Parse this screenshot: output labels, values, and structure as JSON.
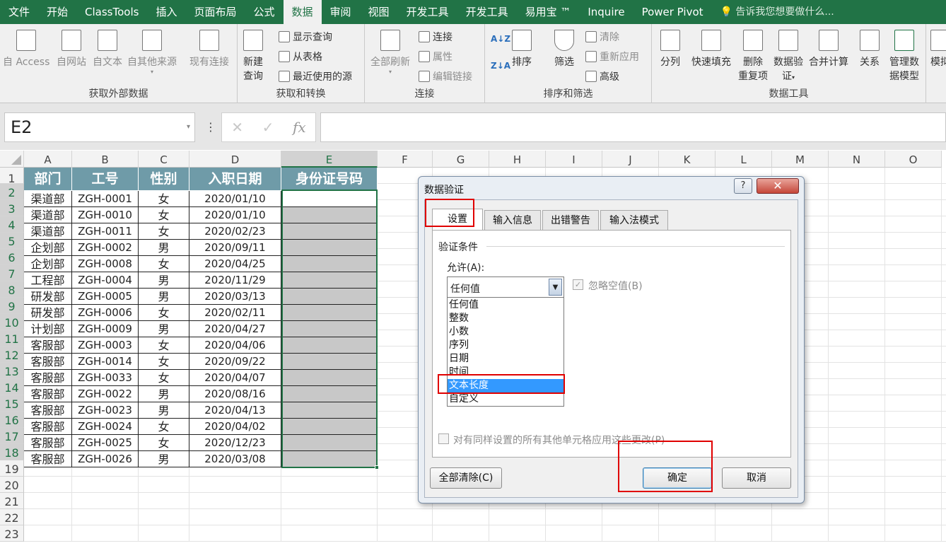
{
  "menu": {
    "tabs": [
      "文件",
      "开始",
      "ClassTools",
      "插入",
      "页面布局",
      "公式",
      "数据",
      "审阅",
      "视图",
      "开发工具",
      "开发工具",
      "易用宝 ™",
      "Inquire",
      "Power Pivot"
    ],
    "active_index": 6,
    "tell_me": "告诉我您想要做什么..."
  },
  "ribbon": {
    "get_external": {
      "label": "获取外部数据",
      "from_access": "自 Access",
      "from_web": "自网站",
      "from_text": "自文本",
      "from_other": "自其他来源",
      "existing": "现有连接"
    },
    "get_transform": {
      "label": "获取和转换",
      "new_query_1": "新建",
      "new_query_2": "查询",
      "show_query": "显示查询",
      "from_table": "从表格",
      "recent": "最近使用的源"
    },
    "connections": {
      "label": "连接",
      "refresh_all": "全部刷新",
      "connections": "连接",
      "properties": "属性",
      "edit_links": "编辑链接"
    },
    "sort_filter": {
      "label": "排序和筛选",
      "sort": "排序",
      "filter": "筛选",
      "clear": "清除",
      "reapply": "重新应用",
      "advanced": "高级"
    },
    "data_tools": {
      "label": "数据工具",
      "split": "分列",
      "flash_fill": "快速填充",
      "remove_dup_1": "删除",
      "remove_dup_2": "重复项",
      "validation_1": "数据验",
      "validation_2": "证",
      "consolidate": "合并计算",
      "relationships": "关系",
      "manage_model_1": "管理数",
      "manage_model_2": "据模型",
      "what_if": "模拟"
    }
  },
  "formula_bar": {
    "name_box": "E2",
    "fx": "fx",
    "cancel": "✕",
    "enter": "✓"
  },
  "sheet": {
    "columns": [
      "A",
      "B",
      "C",
      "D",
      "E",
      "F",
      "G",
      "H",
      "I",
      "J",
      "K",
      "L",
      "M",
      "N",
      "O"
    ],
    "headers": [
      "部门",
      "工号",
      "性别",
      "入职日期",
      "身份证号码"
    ],
    "rows": [
      [
        "渠道部",
        "ZGH-0001",
        "女",
        "2020/01/10"
      ],
      [
        "渠道部",
        "ZGH-0010",
        "女",
        "2020/01/10"
      ],
      [
        "渠道部",
        "ZGH-0011",
        "女",
        "2020/02/23"
      ],
      [
        "企划部",
        "ZGH-0002",
        "男",
        "2020/09/11"
      ],
      [
        "企划部",
        "ZGH-0008",
        "女",
        "2020/04/25"
      ],
      [
        "工程部",
        "ZGH-0004",
        "男",
        "2020/11/29"
      ],
      [
        "研发部",
        "ZGH-0005",
        "男",
        "2020/03/13"
      ],
      [
        "研发部",
        "ZGH-0006",
        "女",
        "2020/02/11"
      ],
      [
        "计划部",
        "ZGH-0009",
        "男",
        "2020/04/27"
      ],
      [
        "客服部",
        "ZGH-0003",
        "女",
        "2020/04/06"
      ],
      [
        "客服部",
        "ZGH-0014",
        "女",
        "2020/09/22"
      ],
      [
        "客服部",
        "ZGH-0033",
        "女",
        "2020/04/07"
      ],
      [
        "客服部",
        "ZGH-0022",
        "男",
        "2020/08/16"
      ],
      [
        "客服部",
        "ZGH-0023",
        "男",
        "2020/04/13"
      ],
      [
        "客服部",
        "ZGH-0024",
        "女",
        "2020/04/02"
      ],
      [
        "客服部",
        "ZGH-0025",
        "女",
        "2020/12/23"
      ],
      [
        "客服部",
        "ZGH-0026",
        "男",
        "2020/03/08"
      ]
    ],
    "row_numbers": [
      "1",
      "2",
      "3",
      "4",
      "5",
      "6",
      "7",
      "8",
      "9",
      "10",
      "11",
      "12",
      "13",
      "14",
      "15",
      "16",
      "17",
      "18",
      "19",
      "20",
      "21",
      "22",
      "23"
    ]
  },
  "dialog": {
    "title": "数据验证",
    "help": "?",
    "close": "✕",
    "tabs": [
      "设置",
      "输入信息",
      "出错警告",
      "输入法模式"
    ],
    "section": "验证条件",
    "allow_label": "允许(A):",
    "allow_value": "任何值",
    "ignore_blank": "忽略空值(B)",
    "options": [
      "任何值",
      "整数",
      "小数",
      "序列",
      "日期",
      "时间",
      "文本长度",
      "自定义"
    ],
    "highlighted_option": "文本长度",
    "apply_all": "对有同样设置的所有其他单元格应用这些更改(P)",
    "clear_all": "全部清除(C)",
    "ok": "确定",
    "cancel": "取消"
  },
  "colors": {
    "excel_green": "#217346",
    "header_fill": "#6f9ba8",
    "selected_fill": "#c8c8c8",
    "highlight": "#3399ff",
    "annotation_red": "#e00000"
  }
}
